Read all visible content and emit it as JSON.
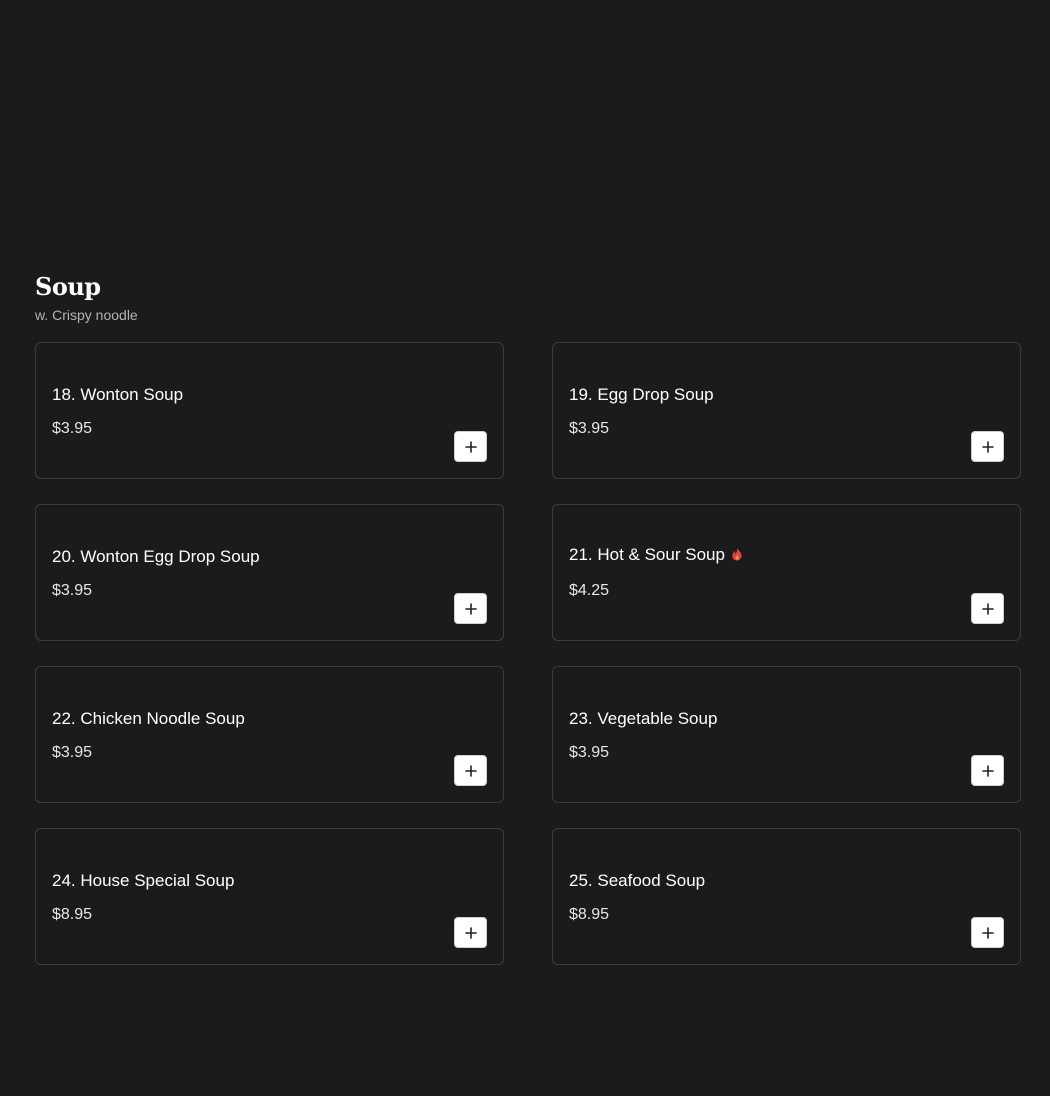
{
  "section": {
    "title": "Soup",
    "subtitle": "w. Crispy noodle"
  },
  "colors": {
    "background": "#1b1b1b",
    "card_border": "#3c3c3c",
    "spicy": "#e0463c"
  },
  "items": [
    {
      "name": "18. Wonton Soup",
      "price": "$3.95",
      "spicy": false
    },
    {
      "name": "19. Egg Drop Soup",
      "price": "$3.95",
      "spicy": false
    },
    {
      "name": "20. Wonton Egg Drop Soup",
      "price": "$3.95",
      "spicy": false
    },
    {
      "name": "21. Hot & Sour Soup",
      "price": "$4.25",
      "spicy": true,
      "spicy_icon": "flame-icon"
    },
    {
      "name": "22. Chicken Noodle Soup",
      "price": "$3.95",
      "spicy": false
    },
    {
      "name": "23. Vegetable Soup",
      "price": "$3.95",
      "spicy": false
    },
    {
      "name": "24. House Special Soup",
      "price": "$8.95",
      "spicy": false
    },
    {
      "name": "25. Seafood Soup",
      "price": "$8.95",
      "spicy": false
    }
  ],
  "icons": {
    "add": "plus-icon",
    "spicy": "flame-icon"
  }
}
